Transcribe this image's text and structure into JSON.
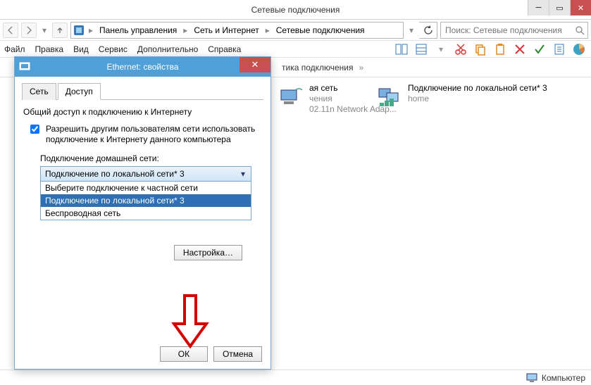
{
  "window": {
    "title": "Сетевые подключения"
  },
  "breadcrumb": {
    "items": [
      "Панель управления",
      "Сеть и Интернет",
      "Сетевые подключения"
    ]
  },
  "search": {
    "placeholder": "Поиск: Сетевые подключения"
  },
  "menubar": [
    "Файл",
    "Правка",
    "Вид",
    "Сервис",
    "Дополнительно",
    "Справка"
  ],
  "subtoolbar": {
    "label": "тика подключения"
  },
  "connections": [
    {
      "title": "ая сеть",
      "line2": "чения",
      "line3": "02.11n Network Adap..."
    },
    {
      "title": "Подключение по локальной сети* 3",
      "line2": "home",
      "line3": ""
    }
  ],
  "statusbar": {
    "right_label": "Компьютер"
  },
  "dialog": {
    "title": "Ethernet: свойства",
    "tabs": [
      "Сеть",
      "Доступ"
    ],
    "active_tab": 1,
    "section": "Общий доступ к подключению к Интернету",
    "check1": "Разрешить другим пользователям сети использовать подключение к Интернету данного компьютера",
    "combo_label": "Подключение домашней сети:",
    "combo_selected": "Подключение по локальной сети* 3",
    "combo_options": [
      "Выберите подключение к частной сети",
      "Подключение по локальной сети* 3",
      "Беспроводная сеть"
    ],
    "config_btn": "Настройка…",
    "ok": "ОК",
    "cancel": "Отмена"
  }
}
